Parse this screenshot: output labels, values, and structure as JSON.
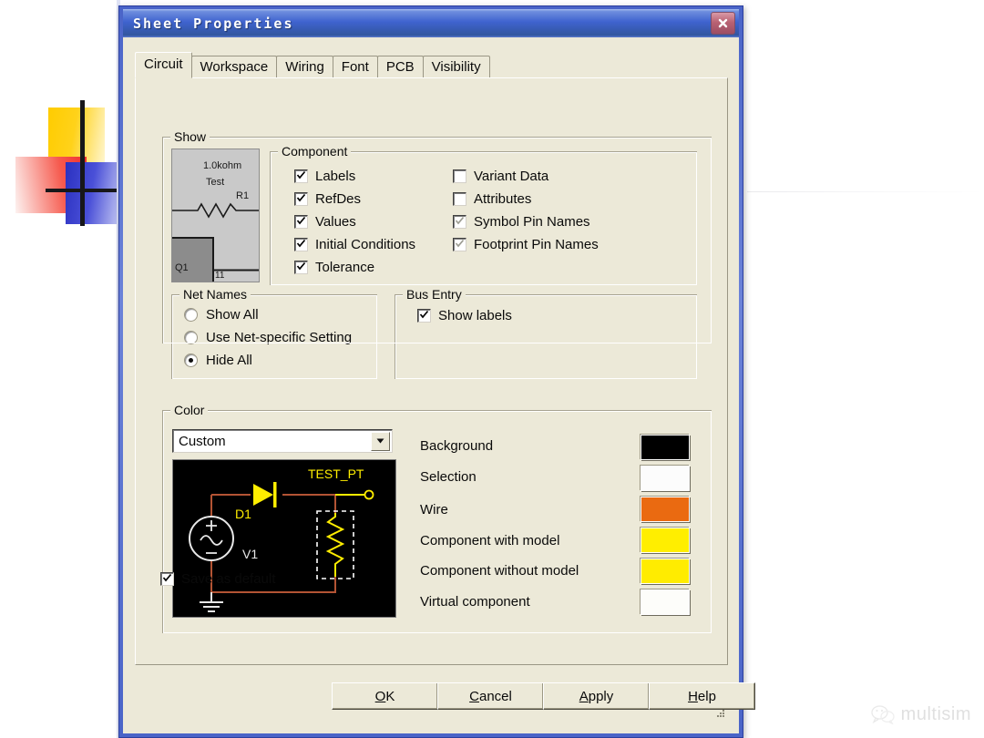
{
  "window": {
    "title": "Sheet Properties",
    "close_icon": "close-icon"
  },
  "tabs": [
    {
      "label": "Circuit",
      "active": true
    },
    {
      "label": "Workspace",
      "active": false
    },
    {
      "label": "Wiring",
      "active": false
    },
    {
      "label": "Font",
      "active": false
    },
    {
      "label": "PCB",
      "active": false
    },
    {
      "label": "Visibility",
      "active": false
    }
  ],
  "show_group": {
    "title": "Show",
    "preview": {
      "value_label": "1.0kohm",
      "name_label": "Test",
      "refdes_label": "R1",
      "transistor_label": "Q1",
      "pin_label": "11"
    }
  },
  "component_group": {
    "title": "Component",
    "left_items": [
      {
        "label": "Labels",
        "checked": true,
        "disabled": false
      },
      {
        "label": "RefDes",
        "checked": true,
        "disabled": false
      },
      {
        "label": "Values",
        "checked": true,
        "disabled": false
      },
      {
        "label": "Initial Conditions",
        "checked": true,
        "disabled": false
      },
      {
        "label": "Tolerance",
        "checked": true,
        "disabled": false
      }
    ],
    "right_items": [
      {
        "label": "Variant Data",
        "checked": false,
        "disabled": false
      },
      {
        "label": "Attributes",
        "checked": false,
        "disabled": false
      },
      {
        "label": "Symbol Pin Names",
        "checked": true,
        "disabled": true
      },
      {
        "label": "Footprint Pin Names",
        "checked": true,
        "disabled": true
      }
    ]
  },
  "net_names_group": {
    "title": "Net Names",
    "options": [
      {
        "label": "Show All",
        "selected": false
      },
      {
        "label": "Use Net-specific Setting",
        "selected": false
      },
      {
        "label": "Hide All",
        "selected": true
      }
    ]
  },
  "bus_entry_group": {
    "title": "Bus Entry",
    "items": [
      {
        "label": "Show labels",
        "checked": true
      }
    ]
  },
  "color_group": {
    "title": "Color",
    "scheme_selected": "Custom",
    "dropdown_icon": "chevron-down-icon",
    "swatches": [
      {
        "label": "Background",
        "color": "#000000"
      },
      {
        "label": "Selection",
        "color": "#fcfcfc"
      },
      {
        "label": "Wire",
        "color": "#ea6a11"
      },
      {
        "label": "Component with model",
        "color": "#ffee00"
      },
      {
        "label": "Component without model",
        "color": "#ffec00"
      },
      {
        "label": "Virtual component",
        "color": "#fdfdfa"
      }
    ],
    "circuit_preview": {
      "background": "#000000",
      "wire_color": "#b35434",
      "component_color": "#ffee00",
      "virtual_color": "#e8e8e8",
      "selection_color": "#ffffff",
      "labels": [
        {
          "text": "TEST_PT",
          "color": "#ffee00"
        },
        {
          "text": "D1",
          "color": "#ffee00"
        },
        {
          "text": "V1",
          "color": "#e8e8e8"
        }
      ]
    }
  },
  "footer": {
    "save_as_default": {
      "label": "Save as default",
      "checked": true
    },
    "buttons": [
      {
        "pre": "",
        "accel": "O",
        "post": "K"
      },
      {
        "pre": "",
        "accel": "C",
        "post": "ancel"
      },
      {
        "pre": "",
        "accel": "A",
        "post": "pply"
      },
      {
        "pre": "",
        "accel": "H",
        "post": "elp"
      }
    ]
  },
  "watermark": {
    "text": "multisim",
    "icon": "wechat-icon"
  }
}
